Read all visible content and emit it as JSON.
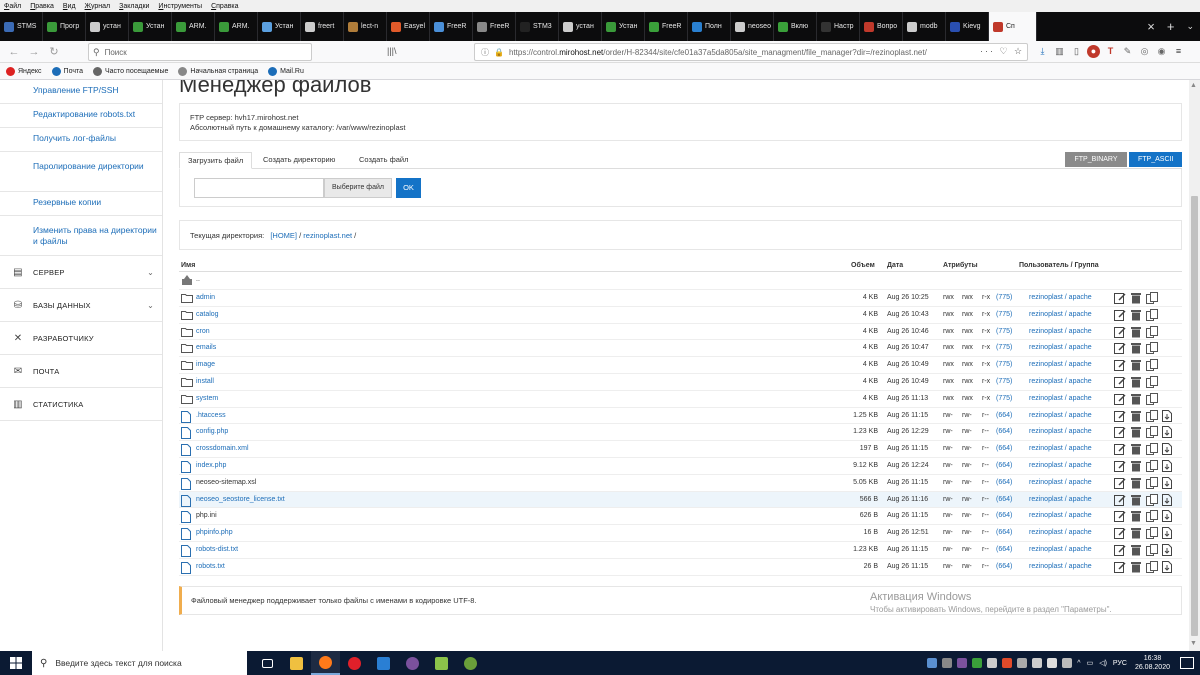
{
  "menubar": [
    "Файл",
    "Правка",
    "Вид",
    "Журнал",
    "Закладки",
    "Инструменты",
    "Справка"
  ],
  "tabs": [
    {
      "label": "STMS",
      "color": "#3b6bb5"
    },
    {
      "label": "Прогр",
      "color": "#3a9a3a"
    },
    {
      "label": "устан",
      "color": "#cccccc"
    },
    {
      "label": "Устан",
      "color": "#3a9a3a"
    },
    {
      "label": "ARM.",
      "color": "#3a9a3a"
    },
    {
      "label": "ARM.",
      "color": "#3a9a3a"
    },
    {
      "label": "Устан",
      "color": "#5ba0e0"
    },
    {
      "label": "freert",
      "color": "#cccccc"
    },
    {
      "label": "lect-n",
      "color": "#b07d3a"
    },
    {
      "label": "Easyel",
      "color": "#e05a2a"
    },
    {
      "label": "FreeR",
      "color": "#4a8fd8"
    },
    {
      "label": "FreeR",
      "color": "#888888"
    },
    {
      "label": "STM3",
      "color": "#222222"
    },
    {
      "label": "устан",
      "color": "#cccccc"
    },
    {
      "label": "Устан",
      "color": "#3a9a3a"
    },
    {
      "label": "FreeR",
      "color": "#3aa03a"
    },
    {
      "label": "Полн",
      "color": "#2a80d0"
    },
    {
      "label": "neoseo",
      "color": "#cccccc"
    },
    {
      "label": "Вклю",
      "color": "#3aa03a"
    },
    {
      "label": "Настр",
      "color": "#333333"
    },
    {
      "label": "Вопро",
      "color": "#c0392b"
    },
    {
      "label": "modb",
      "color": "#cccccc"
    },
    {
      "label": "Kievg",
      "color": "#2a4fb0"
    },
    {
      "label": "Сп",
      "color": "#c0392b"
    }
  ],
  "nav": {
    "search_placeholder": "Поиск",
    "url_prefix": "https://control.",
    "url_host": "mirohost.net",
    "url_rest": "/order/H-82344/site/cfe01a37a5da805a/site_managment/file_manager?dir=/rezinoplast.net/"
  },
  "bookmarks": [
    {
      "label": "Яндекс",
      "color": "#d22"
    },
    {
      "label": "Почта",
      "color": "#1c6db8"
    },
    {
      "label": "Часто посещаемые",
      "color": "#666"
    },
    {
      "label": "Начальная страница",
      "color": "#888"
    },
    {
      "label": "Mail.Ru",
      "color": "#1c6db8"
    }
  ],
  "sidebar": {
    "subitems": [
      {
        "label": "Управление FTP/SSH",
        "two": false
      },
      {
        "label": "Редактирование robots.txt",
        "two": false
      },
      {
        "label": "Получить лог-файлы",
        "two": false
      },
      {
        "label": "Паролирование директории",
        "two": true
      },
      {
        "label": "Резервные копии",
        "two": false
      },
      {
        "label": "Изменить права на директории и файлы",
        "two": true
      }
    ],
    "sections": [
      {
        "label": "СЕРВЕР",
        "icon": "server-icon"
      },
      {
        "label": "БАЗЫ ДАННЫХ",
        "icon": "database-icon"
      },
      {
        "label": "РАЗРАБОТЧИКУ",
        "icon": "tools-icon"
      },
      {
        "label": "ПОЧТА",
        "icon": "mail-icon"
      },
      {
        "label": "СТАТИСТИКА",
        "icon": "chart-icon"
      }
    ]
  },
  "main": {
    "title": "Менеджер файлов",
    "ftp_server": "FTP сервер: hvh17.mirohost.net",
    "abs_path": "Абсолютный путь к домашнему каталогу: /var/www/rezinoplast",
    "tabs": [
      "Загрузить файл",
      "Создать директорию",
      "Создать файл"
    ],
    "ftp_binary": "FTP_BINARY",
    "ftp_ascii": "FTP_ASCII",
    "choose_file": "Выберите файл",
    "ok": "OK",
    "curdir_label": "Текущая директория:",
    "curdir_home": "[HOME]",
    "curdir_sep1": "/",
    "curdir_site": "rezinoplast.net",
    "curdir_sep2": "/",
    "notice": "Файловый менеджер поддерживает только файлы с именами в кодировке UTF-8."
  },
  "table": {
    "headers": {
      "name": "Имя",
      "size": "Объем",
      "date": "Дата",
      "attrs": "Атрибуты",
      "owner": "Пользователь / Группа"
    },
    "up": "..",
    "rows": [
      {
        "name": "admin",
        "type": "dir",
        "size": "4 KB",
        "date": "Aug 26 10:25",
        "a": [
          "rwx",
          "rwx",
          "r-x"
        ],
        "perm": "(775)",
        "owner": "rezinoplast / apache"
      },
      {
        "name": "catalog",
        "type": "dir",
        "size": "4 KB",
        "date": "Aug 26 10:43",
        "a": [
          "rwx",
          "rwx",
          "r-x"
        ],
        "perm": "(775)",
        "owner": "rezinoplast / apache"
      },
      {
        "name": "cron",
        "type": "dir",
        "size": "4 KB",
        "date": "Aug 26 10:46",
        "a": [
          "rwx",
          "rwx",
          "r-x"
        ],
        "perm": "(775)",
        "owner": "rezinoplast / apache"
      },
      {
        "name": "emails",
        "type": "dir",
        "size": "4 KB",
        "date": "Aug 26 10:47",
        "a": [
          "rwx",
          "rwx",
          "r-x"
        ],
        "perm": "(775)",
        "owner": "rezinoplast / apache"
      },
      {
        "name": "image",
        "type": "dir",
        "size": "4 KB",
        "date": "Aug 26 10:49",
        "a": [
          "rwx",
          "rwx",
          "r-x"
        ],
        "perm": "(775)",
        "owner": "rezinoplast / apache"
      },
      {
        "name": "install",
        "type": "dir",
        "size": "4 KB",
        "date": "Aug 26 10:49",
        "a": [
          "rwx",
          "rwx",
          "r-x"
        ],
        "perm": "(775)",
        "owner": "rezinoplast / apache"
      },
      {
        "name": "system",
        "type": "dir",
        "size": "4 KB",
        "date": "Aug 26 11:13",
        "a": [
          "rwx",
          "rwx",
          "r-x"
        ],
        "perm": "(775)",
        "owner": "rezinoplast / apache"
      },
      {
        "name": ".htaccess",
        "type": "file",
        "size": "1.25 KB",
        "date": "Aug 26 11:15",
        "a": [
          "rw-",
          "rw-",
          "r--"
        ],
        "perm": "(664)",
        "owner": "rezinoplast / apache"
      },
      {
        "name": "config.php",
        "type": "file",
        "size": "1.23 KB",
        "date": "Aug 26 12:29",
        "a": [
          "rw-",
          "rw-",
          "r--"
        ],
        "perm": "(664)",
        "owner": "rezinoplast / apache"
      },
      {
        "name": "crossdomain.xml",
        "type": "file",
        "size": "197 B",
        "date": "Aug 26 11:15",
        "a": [
          "rw-",
          "rw-",
          "r--"
        ],
        "perm": "(664)",
        "owner": "rezinoplast / apache"
      },
      {
        "name": "index.php",
        "type": "file",
        "size": "9.12 KB",
        "date": "Aug 26 12:24",
        "a": [
          "rw-",
          "rw-",
          "r--"
        ],
        "perm": "(664)",
        "owner": "rezinoplast / apache"
      },
      {
        "name": "neoseo-sitemap.xsl",
        "type": "file",
        "plain": true,
        "size": "5.05 KB",
        "date": "Aug 26 11:15",
        "a": [
          "rw-",
          "rw-",
          "r--"
        ],
        "perm": "(664)",
        "owner": "rezinoplast / apache"
      },
      {
        "name": "neoseo_seostore_license.txt",
        "type": "file",
        "highlight": true,
        "size": "566 B",
        "date": "Aug 26 11:16",
        "a": [
          "rw-",
          "rw-",
          "r--"
        ],
        "perm": "(664)",
        "owner": "rezinoplast / apache"
      },
      {
        "name": "php.ini",
        "type": "file",
        "plain": true,
        "size": "626 B",
        "date": "Aug 26 11:15",
        "a": [
          "rw-",
          "rw-",
          "r--"
        ],
        "perm": "(664)",
        "owner": "rezinoplast / apache"
      },
      {
        "name": "phpinfo.php",
        "type": "file",
        "size": "16 B",
        "date": "Aug 26 12:51",
        "a": [
          "rw-",
          "rw-",
          "r--"
        ],
        "perm": "(664)",
        "owner": "rezinoplast / apache"
      },
      {
        "name": "robots-dist.txt",
        "type": "file",
        "size": "1.23 KB",
        "date": "Aug 26 11:15",
        "a": [
          "rw-",
          "rw-",
          "r--"
        ],
        "perm": "(664)",
        "owner": "rezinoplast / apache"
      },
      {
        "name": "robots.txt",
        "type": "file",
        "size": "26 B",
        "date": "Aug 26 11:15",
        "a": [
          "rw-",
          "rw-",
          "r--"
        ],
        "perm": "(664)",
        "owner": "rezinoplast / apache"
      }
    ]
  },
  "watermark": {
    "line1": "Активация Windows",
    "line2": "Чтобы активировать Windows, перейдите в раздел \"Параметры\"."
  },
  "taskbar": {
    "search": "Введите здесь текст для поиска",
    "lang": "РУС",
    "time": "16:38",
    "date": "26.08.2020"
  },
  "colors": {
    "accent": "#1473c7",
    "ftp_binary": "#8a8a8a",
    "ftp_ascii": "#1473c7",
    "link": "#1c6db8",
    "notice_border": "#f0ad4e"
  }
}
